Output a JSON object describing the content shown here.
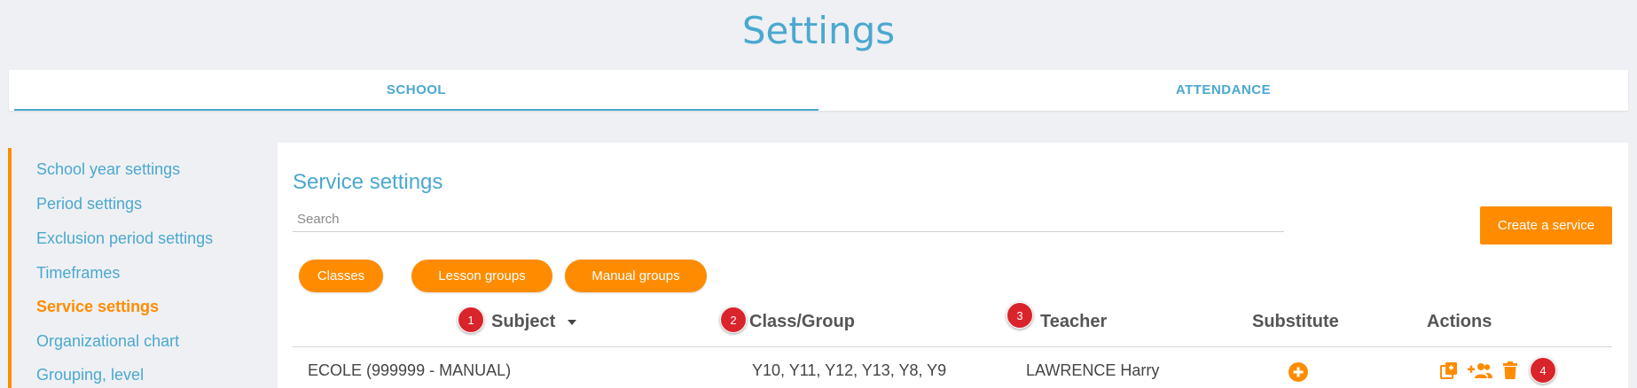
{
  "page": {
    "title": "Settings"
  },
  "tabs": [
    {
      "label": "SCHOOL",
      "active": true
    },
    {
      "label": "ATTENDANCE",
      "active": false
    }
  ],
  "sidebar": {
    "items": [
      {
        "label": "School year settings"
      },
      {
        "label": "Period settings"
      },
      {
        "label": "Exclusion period settings"
      },
      {
        "label": "Timeframes"
      },
      {
        "label": "Service settings",
        "active": true
      },
      {
        "label": "Organizational chart"
      },
      {
        "label": "Grouping, level"
      }
    ]
  },
  "panel": {
    "title": "Service settings",
    "search": {
      "placeholder": "Search",
      "value": ""
    },
    "create_label": "Create a service",
    "filters": [
      {
        "label": "Classes"
      },
      {
        "label": "Lesson groups"
      },
      {
        "label": "Manual groups"
      }
    ]
  },
  "table": {
    "columns": [
      {
        "label": "Subject",
        "sortable": true
      },
      {
        "label": "Class/Group"
      },
      {
        "label": "Teacher"
      },
      {
        "label": "Substitute"
      },
      {
        "label": "Actions"
      }
    ],
    "rows": [
      {
        "subject": "ECOLE (999999 - MANUAL)",
        "class_group": "Y10, Y11, Y12, Y13, Y8, Y9",
        "teacher": "LAWRENCE Harry",
        "substitute_icon": "add-circle-icon",
        "action_icons": [
          "copy-icon",
          "add-users-icon",
          "trash-icon"
        ]
      }
    ]
  },
  "badges": [
    "1",
    "2",
    "3",
    "4"
  ],
  "colors": {
    "accent": "#ff8c00",
    "primary": "#4aa8d0",
    "badge": "#d9242c",
    "background": "#eff0f3"
  }
}
